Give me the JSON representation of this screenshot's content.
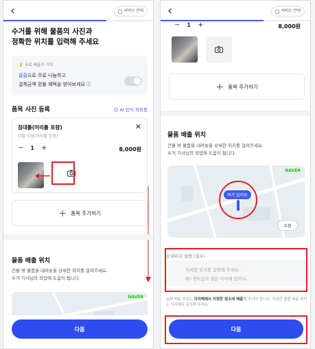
{
  "common": {
    "service_guide": "서비스 안내",
    "back_icon": "‹",
    "next_label": "다음",
    "add_item_label": "품목 추가하기",
    "camera_icon": "camera-icon",
    "accent": "#2e4cf0",
    "highlight": "#e02020"
  },
  "left": {
    "headline_line1": "수거를 위해 물품의 사진과",
    "headline_line2": "정확한 위치를 입력해 주세요",
    "promo_tag": "무료 배출의 기회",
    "promo_line1_highlight": "줍줍",
    "promo_line1_rest": "으로 무료 나눔하고",
    "promo_line2": "결제금액 환불 혜택을 받아보세요",
    "photo_section_title": "품목 사진 등록",
    "ai_label": "AI 인식 작동중",
    "item_name": "침대틀(머리틀 포함)",
    "item_sub": "더블 이상(머리틀 포함)",
    "quantity": "1",
    "price": "8,000원",
    "location_title": "물품 배출 위치",
    "location_desc1": "건물 밖 물품을 내려놓을 상세한 위치를 알려주세요.",
    "location_desc2": "수거 기사님의 작업에 도움이 됩니다.",
    "naver": "NAVER"
  },
  "right": {
    "quantity": "1",
    "price": "8,000원",
    "location_title": "물품 배출 위치",
    "location_desc1": "건물 밖 물품을 내려놓을 상세한 위치를 알려주세요.",
    "location_desc2": "수거 기사님의 작업에 도움이 됩니다.",
    "naver": "NAVER",
    "pin_label": "여기 있어요",
    "edit_label": "수정",
    "memo_label": "상세위치 설명 (필수)",
    "memo_placeholder1": "자세한 위치를 설명해 주세요.",
    "memo_placeholder2": "예) 경비실과 정문 사이에 있어요.",
    "notice_pre": "실제 배출 위치는 ",
    "notice_bold": "지자체에서 지정한 장소에 배출",
    "notice_post": "해 주셔야 합니다. 자세한 물품 배출 위치는 지자체로 문의해 주세요."
  }
}
